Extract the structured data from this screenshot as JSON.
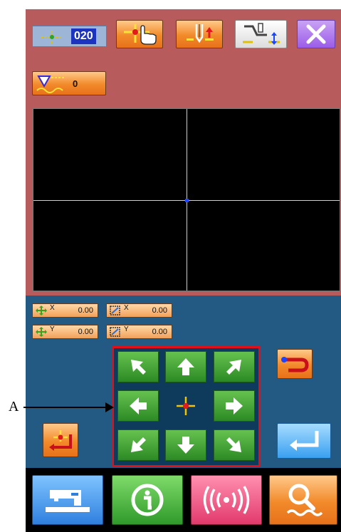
{
  "header": {
    "speed_value": "020",
    "stitch_count": "0"
  },
  "coordinates": {
    "move_x": "0.00",
    "move_y": "0.00",
    "size_x": "0.00",
    "size_y": "0.00",
    "x_label": "X",
    "y_label": "Y"
  },
  "annotation": {
    "marker": "A"
  },
  "icons": {
    "speed": "needle-speed-icon",
    "origin_touch": "origin-touch-icon",
    "needle_up": "needle-up-icon",
    "presser_foot": "presser-foot-icon",
    "close": "close-icon",
    "stitch_counter": "stitch-counter-icon",
    "return": "return-icon",
    "enter": "enter-icon",
    "home": "home-position-icon",
    "sewing_machine": "sewing-machine-icon",
    "info": "info-icon",
    "communication": "communication-icon",
    "search": "search-icon"
  },
  "colors": {
    "top_panel": "#b75b5c",
    "mid_panel": "#235a83",
    "highlight": "#e0101a",
    "accent_orange": "#f28a2a",
    "arrow_green": "#2f8b28"
  }
}
